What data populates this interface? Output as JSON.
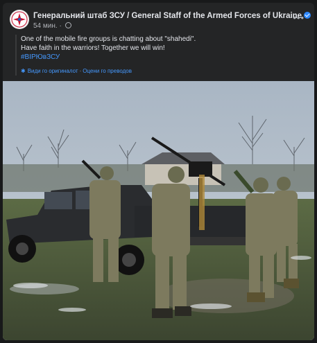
{
  "post": {
    "page_name": "Генеральний штаб ЗСУ / General Staff of the Armed Forces of Ukraine",
    "timestamp": "54 мин.",
    "privacy_icon": "globe-icon",
    "more_icon": "ellipsis-icon",
    "text_lines": [
      "One of the mobile fire groups is chatting about \"shahedi\".",
      "Have faith in the warriors! Together we will win!"
    ],
    "hashtag": "#ВІРЮвЗСУ",
    "see_original": "Види го оригиналот",
    "rate_translation": "Оцени го преводов",
    "separator": "·"
  },
  "colors": {
    "background": "#18191a",
    "card": "#242526",
    "link": "#4599ff",
    "verified": "#2d88ff"
  }
}
